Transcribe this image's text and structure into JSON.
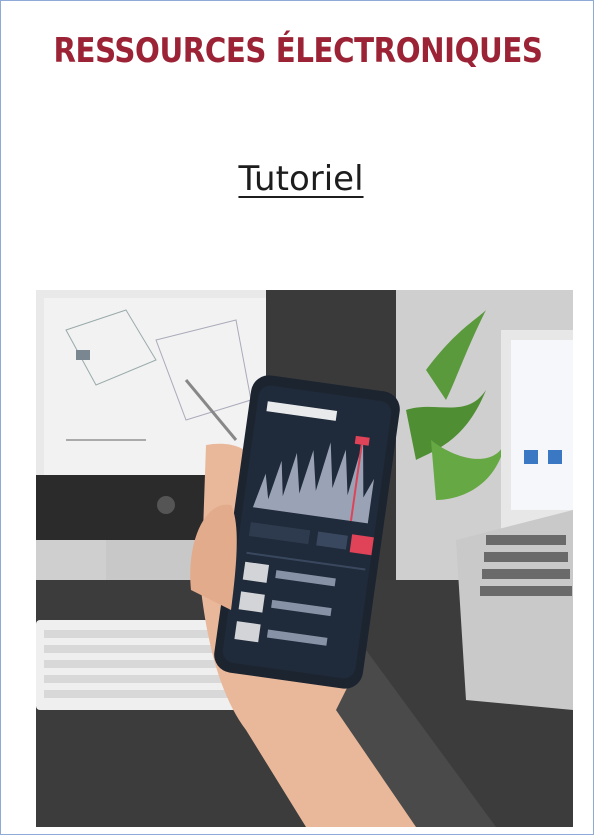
{
  "header": {
    "title": "RESSOURCES ÉLECTRONIQUES"
  },
  "links": {
    "tutorial_label": "Tutoriel"
  },
  "image": {
    "subject": "hand-holding-smartphone-photo"
  },
  "colors": {
    "title": "#9b2335",
    "border": "#8faad6",
    "link": "#1d1d1d"
  }
}
